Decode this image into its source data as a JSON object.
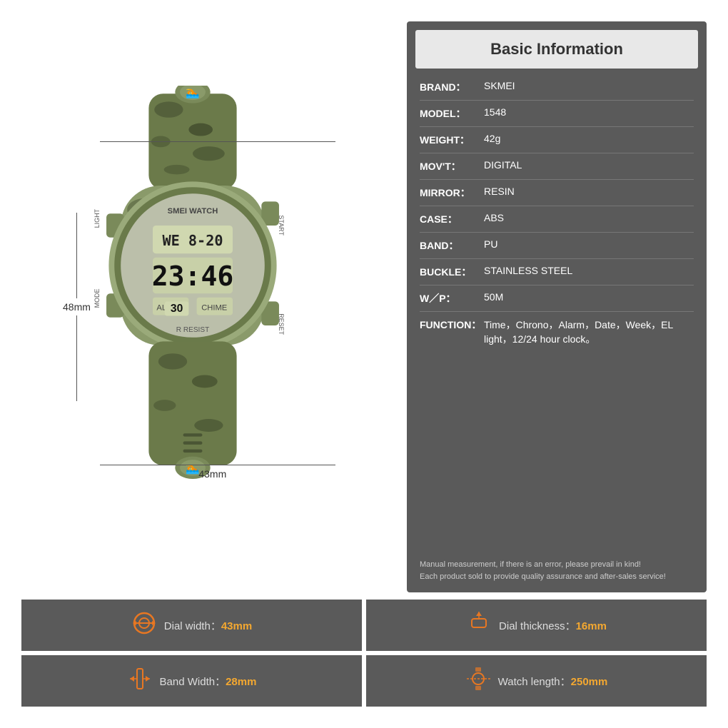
{
  "header": {
    "title": "Basic Information"
  },
  "info_rows": [
    {
      "label": "BRAND：",
      "value": "SKMEI"
    },
    {
      "label": "MODEL：",
      "value": "1548"
    },
    {
      "label": "WEIGHT：",
      "value": "42g"
    },
    {
      "label": "MOV'T：",
      "value": "DIGITAL"
    },
    {
      "label": "MIRROR：",
      "value": "RESIN"
    },
    {
      "label": "CASE：",
      "value": "ABS"
    },
    {
      "label": "BAND：",
      "value": "PU"
    },
    {
      "label": "BUCKLE：",
      "value": "STAINLESS STEEL"
    },
    {
      "label": "W／P：",
      "value": "50M"
    },
    {
      "label": "FUNCTION：",
      "value": "Time，Chrono，Alarm，Date，Week，EL light，12/24 hour clock。"
    }
  ],
  "note_line1": "Manual measurement, if there is an error, please prevail in kind!",
  "note_line2": "Each product sold to provide quality assurance and after-sales service!",
  "dimensions": {
    "height": "48mm",
    "width": "43mm"
  },
  "specs": [
    {
      "id": "dial-width",
      "icon": "⊙",
      "label": "Dial width：",
      "value": "43mm"
    },
    {
      "id": "dial-thickness",
      "icon": "⬡",
      "label": "Dial thickness：",
      "value": "16mm"
    },
    {
      "id": "band-width",
      "icon": "▯",
      "label": "Band Width：",
      "value": "28mm"
    },
    {
      "id": "watch-length",
      "icon": "⊕",
      "label": "Watch length：",
      "value": "250mm"
    }
  ]
}
